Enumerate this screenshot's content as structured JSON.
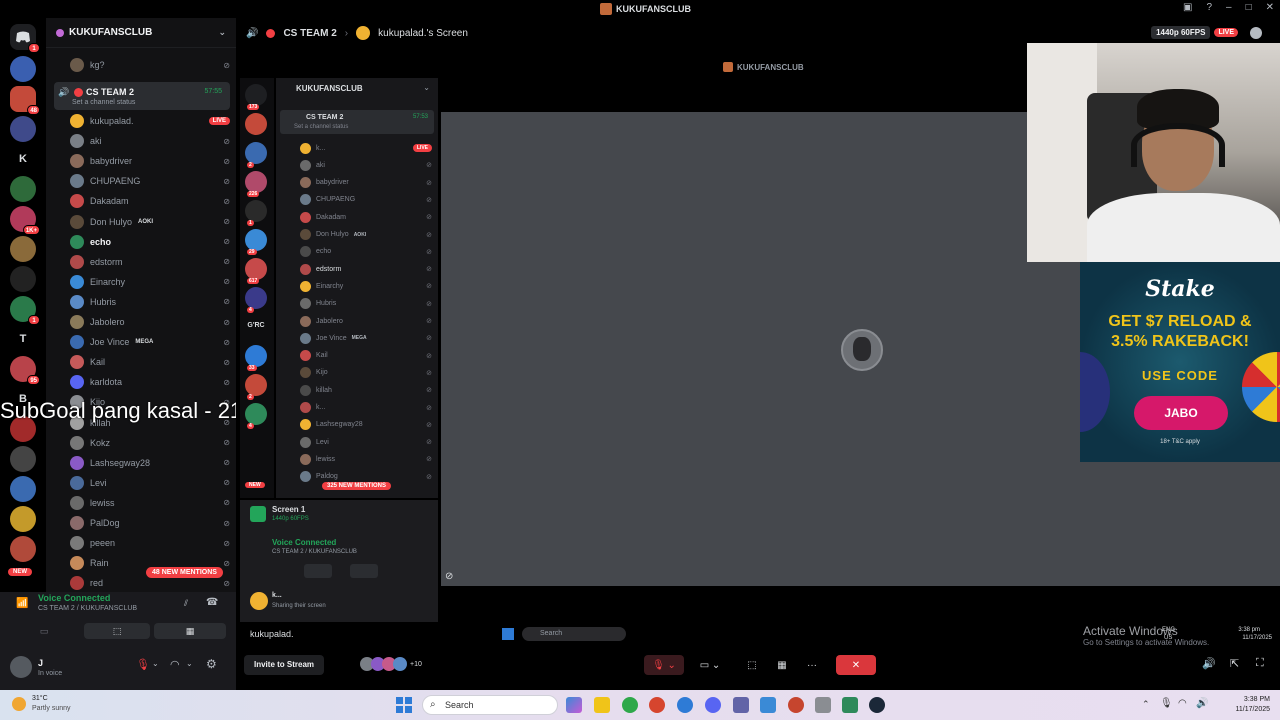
{
  "window": {
    "title": "KUKUFANSCLUB"
  },
  "server_rail": {
    "badges": [
      "1",
      "48",
      "1K+",
      "1",
      "95"
    ],
    "letters": [
      "K",
      "T",
      "B"
    ],
    "new_label": "NEW"
  },
  "sidebar": {
    "guild_name": "KUKUFANSCLUB",
    "top_items": [
      "kg?"
    ],
    "voice_channel": {
      "name": "CS TEAM 2",
      "status": "Set a channel status",
      "time": "57:55"
    },
    "members": [
      {
        "name": "kukupalad.",
        "live": "LIVE"
      },
      {
        "name": "aki"
      },
      {
        "name": "babydriver"
      },
      {
        "name": "CHUPAENG"
      },
      {
        "name": "Dakadam"
      },
      {
        "name": "Don Hulyo",
        "tag": "AOKI"
      },
      {
        "name": "echo"
      },
      {
        "name": "edstorm"
      },
      {
        "name": "Einarchy"
      },
      {
        "name": "Hubris"
      },
      {
        "name": "Jabolero"
      },
      {
        "name": "Joe Vince",
        "tag": "MEGA"
      },
      {
        "name": "Kail"
      },
      {
        "name": "karldota"
      },
      {
        "name": "Kijo"
      },
      {
        "name": "killah"
      },
      {
        "name": "Kokz"
      },
      {
        "name": "Lashsegway28"
      },
      {
        "name": "Levi"
      },
      {
        "name": "lewiss"
      },
      {
        "name": "PalDog"
      },
      {
        "name": "peeen"
      },
      {
        "name": "Rain"
      },
      {
        "name": "red"
      }
    ],
    "mentions": "48 NEW MENTIONS"
  },
  "voice_panel": {
    "title": "Voice Connected",
    "subtitle": "CS TEAM 2 / KUKUFANSCLUB"
  },
  "user_panel": {
    "name": "J",
    "status": "In voice"
  },
  "overlay": {
    "subgoal": "SubGoal pang kasal - 217/3000"
  },
  "header": {
    "channel": "CS TEAM 2",
    "stream_title": "kukupalad.'s Screen",
    "quality": "1440p 60FPS",
    "live": "LIVE"
  },
  "inner": {
    "title": "KUKUFANSCLUB",
    "guild_name": "KUKUFANSCLUB",
    "channel": "CS TEAM 2",
    "channel_status": "Set a channel status",
    "time": "57:53",
    "badges": [
      "173",
      "2",
      "226",
      "1",
      "29",
      "617",
      "4",
      "33",
      "2",
      "4"
    ],
    "grc": "G'RC",
    "new_label": "NEW",
    "members": [
      "k...",
      "aki",
      "babydriver",
      "CHUPAENG",
      "Dakadam",
      "Don Hulyo",
      "echo",
      "edstorm",
      "Einarchy",
      "Hubris",
      "Jabolero",
      "Joe Vince",
      "Kail",
      "Kijo",
      "killah",
      "k...",
      "Lashsegway28",
      "Levi",
      "lewiss",
      "Paldog"
    ],
    "tags": {
      "aoki": "AOKI",
      "mega": "MEGA",
      "live": "LIVE"
    },
    "mentions": "325 NEW MENTIONS",
    "screen_name": "Screen 1",
    "screen_sub": "1440p 60FPS",
    "voice_title": "Voice Connected",
    "voice_sub": "CS TEAM 2 / KUKUFANSCLUB",
    "user_name": "k...",
    "user_status": "Sharing their screen",
    "taskbar_search": "Search",
    "activate_title": "Activate Windows",
    "activate_sub": "Go to Settings to activate Windows.",
    "tray_lang": "ENG",
    "tray_region": "US",
    "tray_time": "3:38 pm",
    "tray_date": "11/17/2025"
  },
  "ad": {
    "brand": "Stake",
    "headline_1": "GET $7 RELOAD &",
    "headline_2": "3.5% RAKEBACK!",
    "code_label": "USE CODE",
    "code": "JABO",
    "fine_print": "18+ T&C apply"
  },
  "controls": {
    "stream_owner": "kukupalad.",
    "invite": "Invite to Stream",
    "viewer_count": "+10"
  },
  "taskbar": {
    "temp": "31°C",
    "weather": "Partly sunny",
    "search": "Search",
    "time": "3:38 PM",
    "date": "11/17/2025"
  },
  "colors": {
    "accent": "#5865f2",
    "live": "#f23f43",
    "voice_green": "#23a55a",
    "ad_yellow": "#f0c419",
    "ad_pink": "#d6186a"
  }
}
